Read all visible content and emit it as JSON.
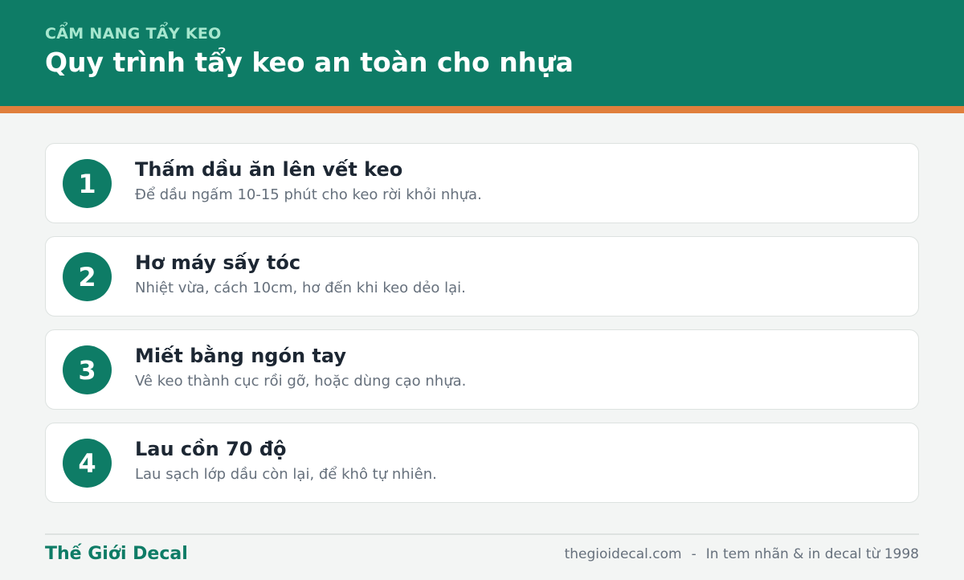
{
  "header": {
    "kicker": "CẨM NANG TẨY KEO",
    "title": "Quy trình tẩy keo an toàn cho nhựa"
  },
  "steps": [
    {
      "number": "1",
      "title": "Thấm dầu ăn lên vết keo",
      "description": "Để dầu ngấm 10-15 phút cho keo rời khỏi nhựa."
    },
    {
      "number": "2",
      "title": "Hơ máy sấy tóc",
      "description": "Nhiệt vừa, cách 10cm, hơ đến khi keo dẻo lại."
    },
    {
      "number": "3",
      "title": "Miết bằng ngón tay",
      "description": "Vê keo thành cục rồi gỡ, hoặc dùng cạo nhựa."
    },
    {
      "number": "4",
      "title": "Lau cồn 70 độ",
      "description": "Lau sạch lớp dầu còn lại, để khô tự nhiên."
    }
  ],
  "footer": {
    "brand": "Thế Giới Decal",
    "website": "thegioidecal.com",
    "separator": "-",
    "tagline": "In tem nhãn & in decal từ 1998"
  },
  "colors": {
    "primary": "#0e7c66",
    "accent": "#e07f3c",
    "background": "#f3f5f4"
  }
}
